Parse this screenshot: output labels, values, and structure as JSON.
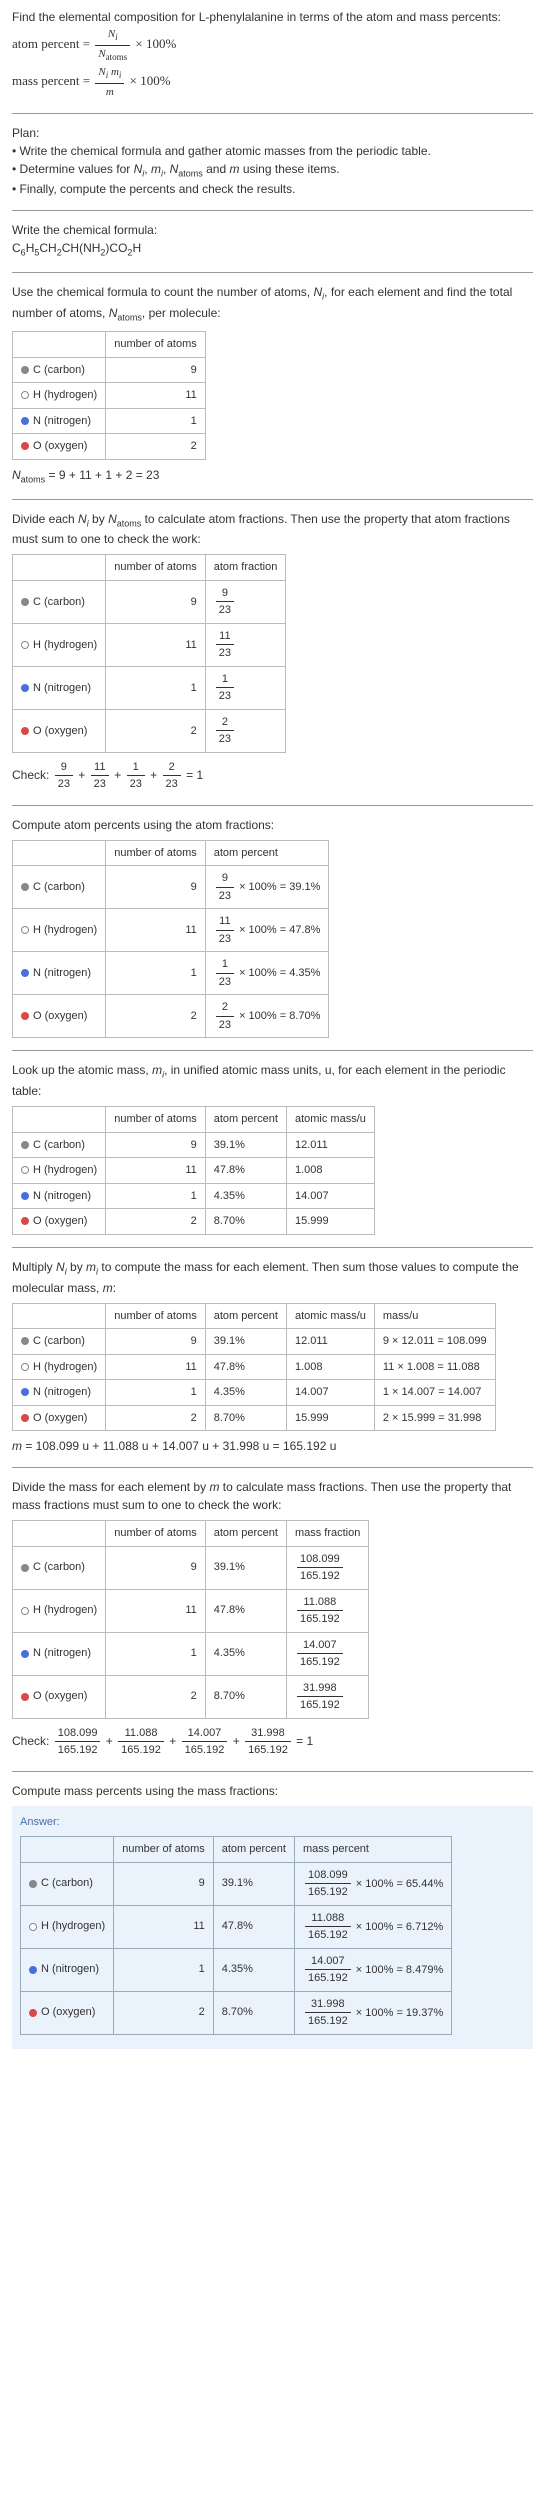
{
  "intro": {
    "line1": "Find the elemental composition for L-phenylalanine in terms of the atom and mass percents:",
    "atom_percent_lhs": "atom percent =",
    "atom_percent_num": "N_i",
    "atom_percent_den": "N_atoms",
    "times100": "× 100%",
    "mass_percent_lhs": "mass percent =",
    "mass_percent_num": "N_i m_i",
    "mass_percent_den": "m"
  },
  "plan": {
    "heading": "Plan:",
    "b1": "• Write the chemical formula and gather atomic masses from the periodic table.",
    "b2": "• Determine values for N_i, m_i, N_atoms and m using these items.",
    "b3": "• Finally, compute the percents and check the results."
  },
  "formula_section": {
    "heading": "Write the chemical formula:",
    "formula": "C₆H₅CH₂CH(NH₂)CO₂H"
  },
  "count_section": {
    "text": "Use the chemical formula to count the number of atoms, N_i, for each element and find the total number of atoms, N_atoms, per molecule:",
    "hdr_atoms": "number of atoms",
    "c_label": "C (carbon)",
    "c_n": "9",
    "h_label": "H (hydrogen)",
    "h_n": "11",
    "n_label": "N (nitrogen)",
    "n_n": "1",
    "o_label": "O (oxygen)",
    "o_n": "2",
    "sum": "N_atoms = 9 + 11 + 1 + 2 = 23"
  },
  "frac_section": {
    "text": "Divide each N_i by N_atoms to calculate atom fractions. Then use the property that atom fractions must sum to one to check the work:",
    "hdr_frac": "atom fraction",
    "c_f_n": "9",
    "c_f_d": "23",
    "h_f_n": "11",
    "h_f_d": "23",
    "n_f_n": "1",
    "n_f_d": "23",
    "o_f_n": "2",
    "o_f_d": "23",
    "check_lhs": "Check:",
    "check_eq": "= 1"
  },
  "atompct_section": {
    "text": "Compute atom percents using the atom fractions:",
    "hdr_pct": "atom percent",
    "c_eq": "× 100% = 39.1%",
    "h_eq": "× 100% = 47.8%",
    "n_eq": "× 100% = 4.35%",
    "o_eq": "× 100% = 8.70%"
  },
  "mass_lookup": {
    "text": "Look up the atomic mass, m_i, in unified atomic mass units, u, for each element in the periodic table:",
    "hdr_mass": "atomic mass/u",
    "c_pct": "39.1%",
    "c_m": "12.011",
    "h_pct": "47.8%",
    "h_m": "1.008",
    "n_pct": "4.35%",
    "n_m": "14.007",
    "o_pct": "8.70%",
    "o_m": "15.999"
  },
  "mass_mult": {
    "text": "Multiply N_i by m_i to compute the mass for each element. Then sum those values to compute the molecular mass, m:",
    "hdr_massu": "mass/u",
    "c_calc": "9 × 12.011 = 108.099",
    "h_calc": "11 × 1.008 = 11.088",
    "n_calc": "1 × 14.007 = 14.007",
    "o_calc": "2 × 15.999 = 31.998",
    "sum": "m = 108.099 u + 11.088 u + 14.007 u + 31.998 u = 165.192 u"
  },
  "massfrac_section": {
    "text": "Divide the mass for each element by m to calculate mass fractions. Then use the property that mass fractions must sum to one to check the work:",
    "hdr_mf": "mass fraction",
    "c_mf_n": "108.099",
    "den": "165.192",
    "h_mf_n": "11.088",
    "n_mf_n": "14.007",
    "o_mf_n": "31.998",
    "check_lhs": "Check:",
    "check_eq": "= 1"
  },
  "final_section": {
    "text": "Compute mass percents using the mass fractions:",
    "answer_label": "Answer:",
    "hdr_masspct": "mass percent",
    "c_eq": "× 100% = 65.44%",
    "h_eq": "× 100% = 6.712%",
    "n_eq": "× 100% = 8.479%",
    "o_eq": "× 100% = 19.37%"
  }
}
